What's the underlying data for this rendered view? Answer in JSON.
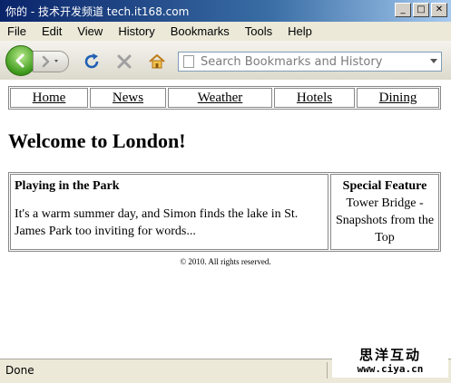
{
  "window": {
    "title": "你的 - 技术开发频道 tech.it168.com",
    "minimize_glyph": "_",
    "maximize_glyph": "□",
    "close_glyph": "✕"
  },
  "menu": {
    "items": [
      "File",
      "Edit",
      "View",
      "History",
      "Bookmarks",
      "Tools",
      "Help"
    ]
  },
  "toolbar": {
    "search_placeholder": "Search Bookmarks and History",
    "icons": [
      "back-icon",
      "forward-icon",
      "dropdown-icon",
      "reload-icon",
      "stop-icon",
      "home-icon",
      "page-icon"
    ]
  },
  "page": {
    "nav_links": [
      "Home",
      "News",
      "Weather",
      "Hotels",
      "Dining"
    ],
    "heading": "Welcome to London!",
    "story": {
      "title": "Playing in the Park",
      "body": "It's a warm summer day, and Simon finds the lake in St. James Park too inviting for words..."
    },
    "feature": {
      "title": "Special Feature",
      "body": "Tower Bridge - Snapshots from the Top"
    },
    "footer": "© 2010. All rights reserved."
  },
  "status": {
    "text": "Done"
  },
  "watermark": {
    "line1": "思洋互动",
    "line2": "www.ciya.cn"
  },
  "colors": {
    "titlebar_start": "#0a246a",
    "back_button": "#3d9a1c",
    "reload_blue": "#1f5fb4"
  }
}
